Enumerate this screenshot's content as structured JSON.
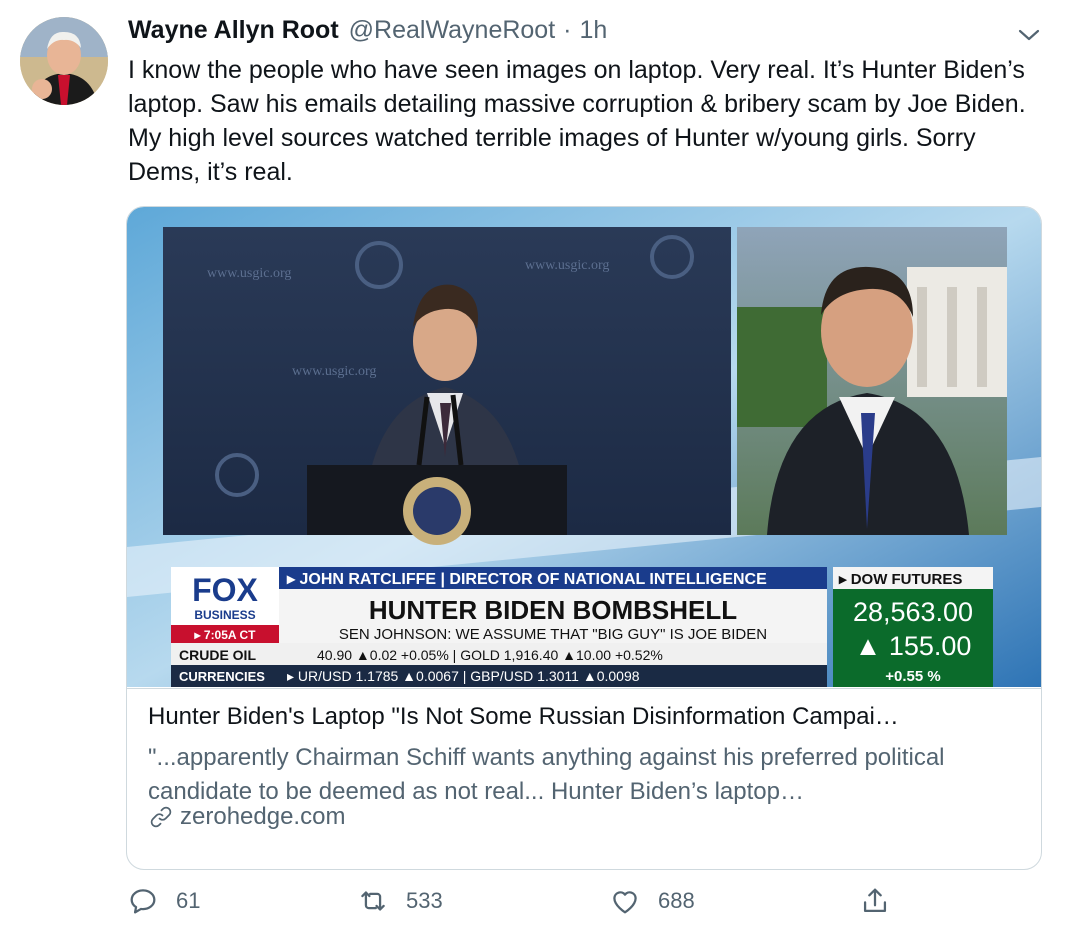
{
  "tweet": {
    "author_name": "Wayne Allyn Root",
    "handle": "@RealWayneRoot",
    "separator": "·",
    "time": "1h",
    "text": "I know the people who have seen images on laptop. Very real. It’s Hunter Biden’s laptop. Saw his emails detailing massive corruption & bribery scam by Joe Biden. My high level sources watched terrible images of Hunter w/young girls. Sorry Dems, it’s real."
  },
  "card": {
    "title": "Hunter Biden's Laptop \"Is Not Some Russian Disinformation Campai…",
    "description": "\"...apparently Chairman Schiff wants anything against his preferred political candidate to be deemed as not real... Hunter Biden’s laptop…",
    "domain": "zerohedge.com",
    "media": {
      "banner_logo": "FOX",
      "banner_logo_sub": "BUSINESS",
      "banner_time": "▸ 7:05A CT",
      "banner_speaker": "▸ JOHN RATCLIFFE | DIRECTOR OF NATIONAL INTELLIGENCE",
      "banner_headline": "HUNTER BIDEN BOMBSHELL",
      "banner_subhead": "SEN JOHNSON: WE ASSUME THAT \"BIG GUY\" IS JOE BIDEN",
      "ticker_label": "▸ DOW FUTURES",
      "ticker_value": "28,563.00",
      "ticker_change": "▲ 155.00",
      "ticker_pct": "+0.55 %",
      "row1_label": "CRUDE OIL",
      "row1_values": "40.90 ▲0.02 +0.05% | GOLD 1,916.40 ▲10.00 +0.52%",
      "row2_label": "CURRENCIES",
      "row2_values": "▸ UR/USD 1.1785 ▲0.0067 | GBP/USD 1.3011 ▲0.0098",
      "podium_sign_1": "www.usgic.org",
      "podium_sign_2": "www.usgic.org",
      "podium_sign_3": "www.usgic.org"
    }
  },
  "actions": {
    "reply_count": "61",
    "retweet_count": "533",
    "like_count": "688"
  },
  "colors": {
    "text_primary": "#0f1419",
    "text_secondary": "#536471",
    "border": "#cfd9de",
    "fox_blue": "#1a3c8c",
    "ticker_green": "#0b6b2b"
  },
  "icons": {
    "caret": "chevron-down-icon",
    "link": "link-icon",
    "reply": "reply-icon",
    "retweet": "retweet-icon",
    "like": "heart-icon",
    "share": "share-icon"
  }
}
